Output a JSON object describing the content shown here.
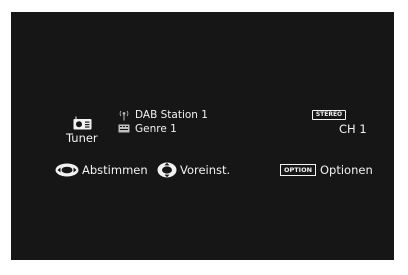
{
  "tuner": {
    "source_label": "Tuner",
    "source_icon": "radio-icon",
    "station_name": "DAB Station 1",
    "station_icon": "antenna-icon",
    "genre": "Genre 1",
    "genre_icon": "genre-icon",
    "stereo_badge": "STEREO",
    "channel": "CH 1"
  },
  "hints": {
    "tune_icon": "dial-left-right-icon",
    "tune_label": "Abstimmen",
    "preset_icon": "dial-up-down-icon",
    "preset_label": "Voreinst.",
    "option_badge": "OPTION",
    "options_label": "Optionen"
  },
  "colors": {
    "background": "#161616",
    "foreground": "#f2f2f2"
  }
}
